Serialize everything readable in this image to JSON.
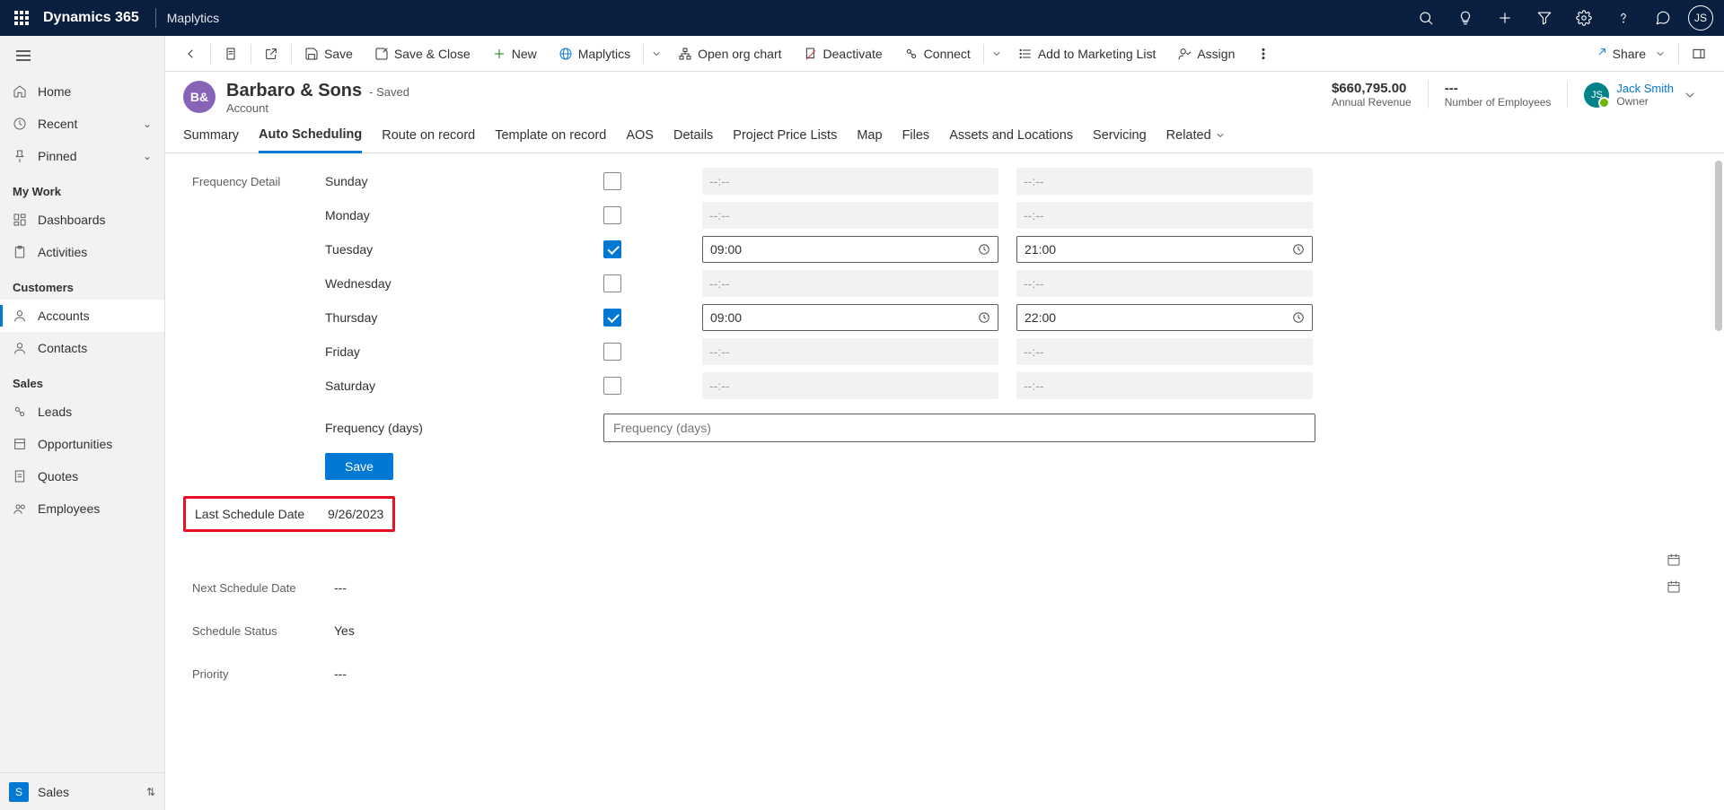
{
  "topbar": {
    "brand": "Dynamics 365",
    "app": "Maplytics",
    "avatar": "JS"
  },
  "sidebar": {
    "items": {
      "home": "Home",
      "recent": "Recent",
      "pinned": "Pinned",
      "mywork": "My Work",
      "dashboards": "Dashboards",
      "activities": "Activities",
      "customers": "Customers",
      "accounts": "Accounts",
      "contacts": "Contacts",
      "sales": "Sales",
      "leads": "Leads",
      "opportunities": "Opportunities",
      "quotes": "Quotes",
      "employees": "Employees"
    },
    "footer": {
      "badge": "S",
      "label": "Sales"
    }
  },
  "cmdbar": {
    "save": "Save",
    "saveclose": "Save & Close",
    "new": "New",
    "maplytics": "Maplytics",
    "openorg": "Open org chart",
    "deactivate": "Deactivate",
    "connect": "Connect",
    "marketing": "Add to Marketing List",
    "assign": "Assign",
    "share": "Share"
  },
  "record": {
    "avatar": "B&",
    "name": "Barbaro & Sons",
    "saved": "- Saved",
    "entity": "Account",
    "revenue_value": "$660,795.00",
    "revenue_label": "Annual Revenue",
    "employees_value": "---",
    "employees_label": "Number of Employees",
    "owner_avatar": "JS",
    "owner_name": "Jack Smith",
    "owner_role": "Owner"
  },
  "tabs": {
    "summary": "Summary",
    "auto": "Auto Scheduling",
    "route": "Route on record",
    "template": "Template on record",
    "aos": "AOS",
    "details": "Details",
    "ppl": "Project Price Lists",
    "map": "Map",
    "files": "Files",
    "assets": "Assets and Locations",
    "servicing": "Servicing",
    "related": "Related"
  },
  "form": {
    "side_label": "Frequency Detail",
    "days": {
      "sun": {
        "label": "Sunday",
        "checked": false,
        "start": "--:--",
        "end": "--:--"
      },
      "mon": {
        "label": "Monday",
        "checked": false,
        "start": "--:--",
        "end": "--:--"
      },
      "tue": {
        "label": "Tuesday",
        "checked": true,
        "start": "09:00",
        "end": "21:00"
      },
      "wed": {
        "label": "Wednesday",
        "checked": false,
        "start": "--:--",
        "end": "--:--"
      },
      "thu": {
        "label": "Thursday",
        "checked": true,
        "start": "09:00",
        "end": "22:00"
      },
      "fri": {
        "label": "Friday",
        "checked": false,
        "start": "--:--",
        "end": "--:--"
      },
      "sat": {
        "label": "Saturday",
        "checked": false,
        "start": "--:--",
        "end": "--:--"
      }
    },
    "freq_label": "Frequency (days)",
    "freq_placeholder": "Frequency (days)",
    "save_btn": "Save",
    "last_label": "Last Schedule Date",
    "last_value": "9/26/2023",
    "next_label": "Next Schedule Date",
    "next_value": "---",
    "status_label": "Schedule Status",
    "status_value": "Yes",
    "priority_label": "Priority",
    "priority_value": "---"
  }
}
